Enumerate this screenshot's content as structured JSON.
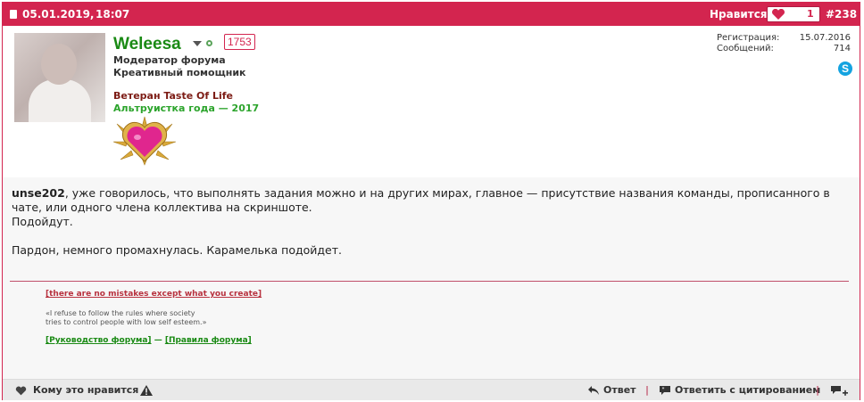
{
  "header": {
    "date": "05.01.2019,",
    "time": "18:07",
    "likes_label": "Нравится:",
    "likes_count": "1",
    "post_number": "#238"
  },
  "profile": {
    "username": "Weleesa",
    "reputation": "1753",
    "role_line1": "Модератор форума",
    "role_line2": "Креативный помощник",
    "award_line1": "Ветеран Taste Of Life",
    "award_line2": "Альтруистка года — 2017",
    "stats": {
      "registration_label": "Регистрация:",
      "registration_value": "15.07.2016",
      "messages_label": "Сообщений:",
      "messages_value": "714"
    }
  },
  "message": {
    "mention": "unse202",
    "text_rest": ", уже говорилось, что выполнять задания можно и на других мирах, главное — присутствие названия команды, прописанного в чате, или одного члена коллектива на скриншоте.",
    "line2": "Подойдут.",
    "line3": "Пардон, немного промахнулась. Карамелька подойдет."
  },
  "signature": {
    "link1": "[there are no mistakes except what you create]",
    "quote_line1": "«I refuse to follow the rules where society",
    "quote_line2": "tries to control people with low self esteem.»",
    "link2": "[Руководство форума]",
    "separator": "—",
    "link3": "[Правила форума]"
  },
  "footer": {
    "who_likes": "Кому это нравится",
    "reply": "Ответ",
    "reply_quote": "Ответить с цитированием",
    "sep": "|"
  },
  "colors": {
    "accent": "#d3254f",
    "username": "#1a8a14",
    "award_green": "#2ca42c",
    "award_brown": "#7c1b14"
  }
}
